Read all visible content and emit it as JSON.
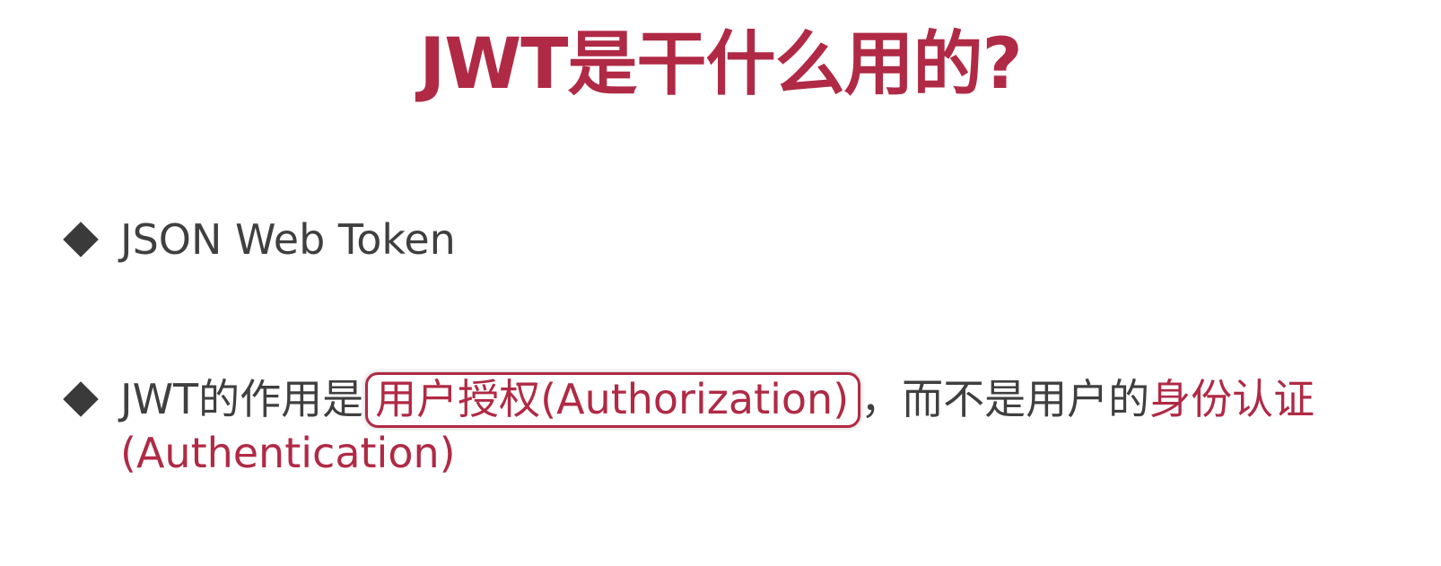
{
  "slide": {
    "title": "JWT是干什么用的?",
    "bullets": [
      {
        "text": "JSON Web Token"
      },
      {
        "prefix": "JWT的作用是",
        "highlight_boxed": "用户授权(Authorization)",
        "middle": "，而不是用户的",
        "highlight": "身份认证",
        "continuation": "(Authentication)"
      }
    ]
  },
  "colors": {
    "accent": "#b02a45",
    "text": "#3f3f3f",
    "bullet": "#3a3a3a",
    "background": "#ffffff"
  },
  "icons": {
    "bullet_marker": "diamond-bullet-icon"
  }
}
